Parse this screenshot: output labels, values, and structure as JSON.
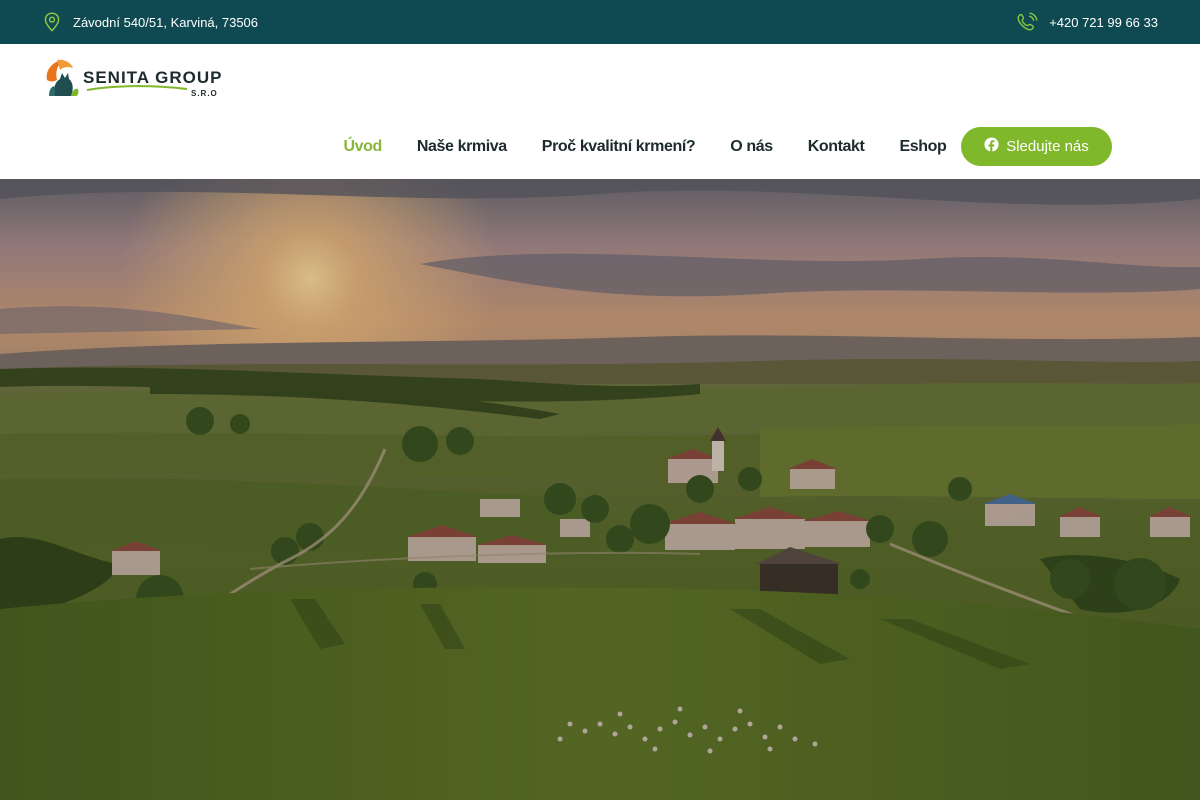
{
  "topbar": {
    "address": "Závodní 540/51, Karviná, 73506",
    "address_icon": "map-pin-icon",
    "phone": "+420 721 99 66 33",
    "phone_icon": "phone-icon"
  },
  "logo": {
    "name": "SENITA GROUP",
    "suffix": "S.R.O"
  },
  "nav": {
    "items": [
      {
        "label": "Úvod",
        "active": true
      },
      {
        "label": "Naše krmiva",
        "active": false
      },
      {
        "label": "Proč kvalitní krmení?",
        "active": false
      },
      {
        "label": "O nás",
        "active": false
      },
      {
        "label": "Kontakt",
        "active": false
      },
      {
        "label": "Eshop",
        "active": false
      }
    ]
  },
  "follow_button": {
    "label": "Sledujte nás",
    "icon": "facebook-icon"
  },
  "colors": {
    "topbar_bg": "#0f4a52",
    "accent_green": "#7fb82b",
    "active_nav": "#86b63a",
    "nav_text": "#1d2b2d"
  }
}
